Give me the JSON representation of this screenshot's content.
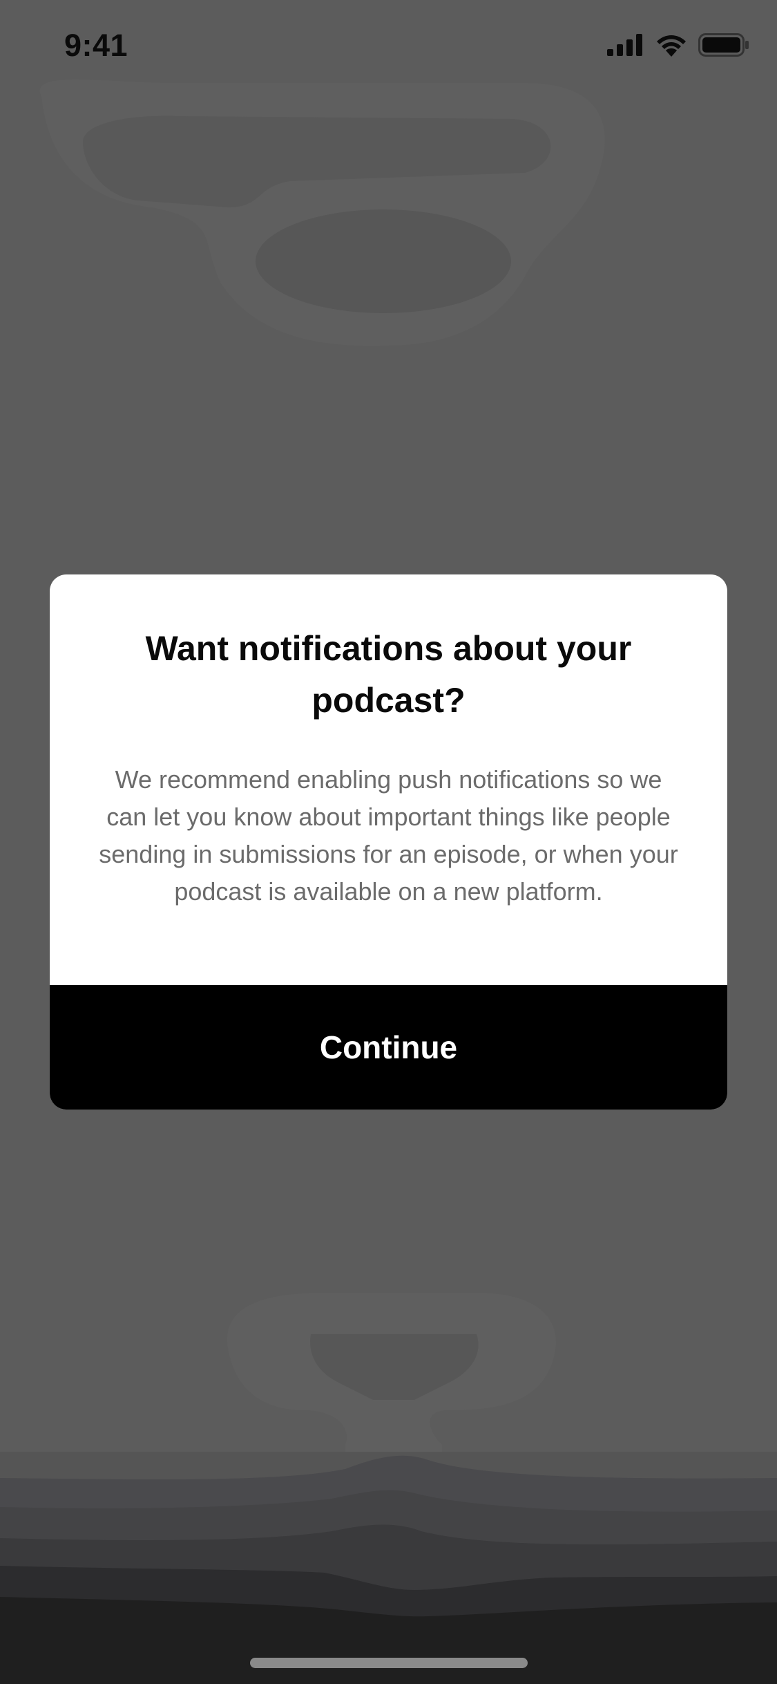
{
  "status_bar": {
    "time": "9:41",
    "icons": [
      "cellular-signal-icon",
      "wifi-icon",
      "battery-icon"
    ]
  },
  "dialog": {
    "title": "Want notifications about your podcast?",
    "body": "We recommend enabling push notifications so we can let you know about important things like people sending in submissions for an episode, or when your podcast is available on a new platform.",
    "button_label": "Continue"
  },
  "colors": {
    "overlay": "#5c5c5c",
    "dialog_bg": "#ffffff",
    "button_bg": "#000000",
    "button_text": "#ffffff",
    "title_text": "#0a0a0a",
    "body_text": "#6b6b6b"
  }
}
